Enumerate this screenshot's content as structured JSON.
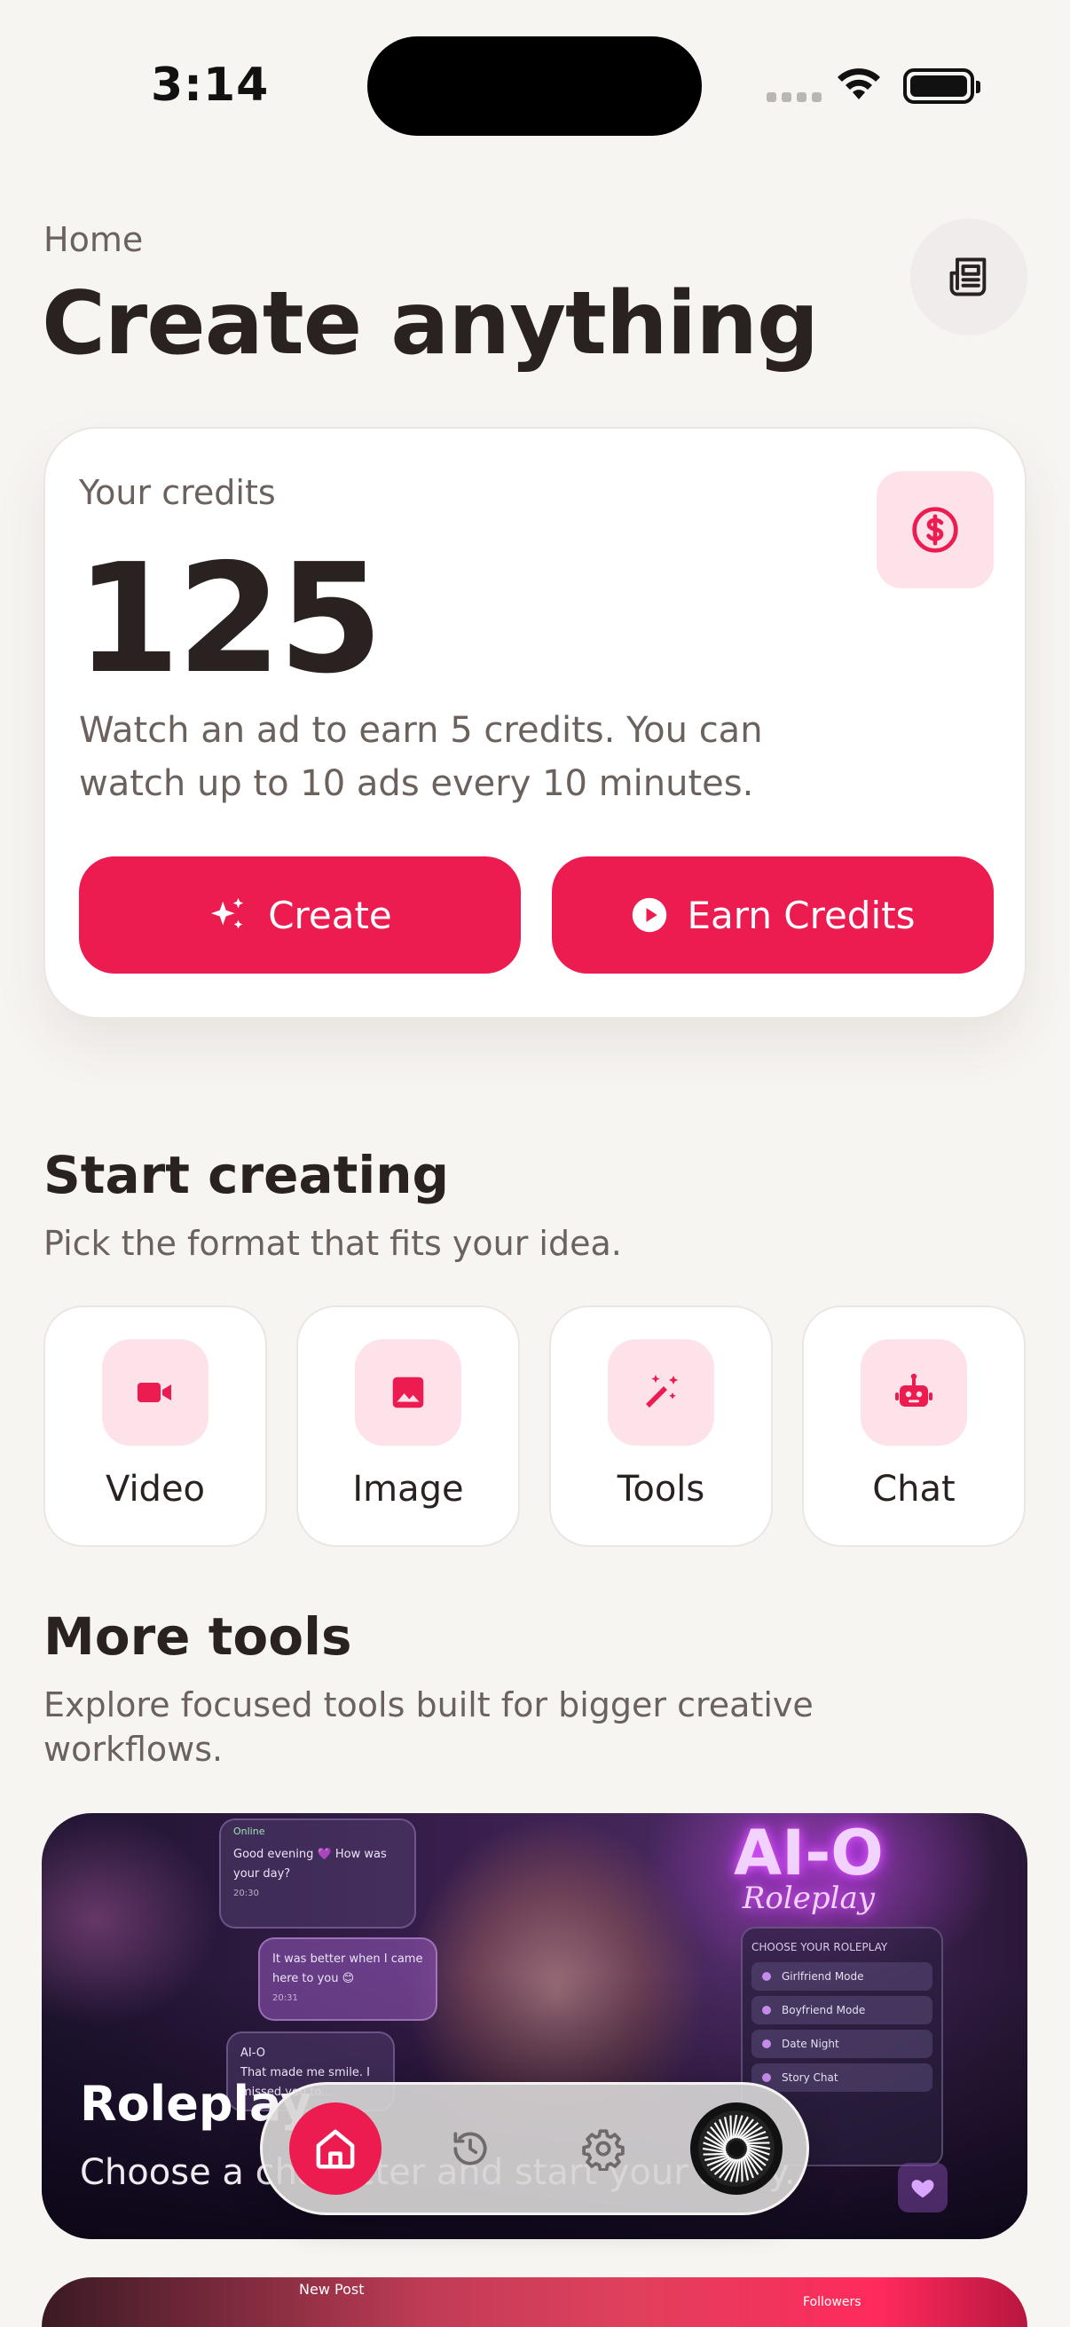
{
  "status_bar": {
    "time": "3:14"
  },
  "header": {
    "breadcrumb": "Home",
    "title": "Create anything"
  },
  "credits": {
    "label": "Your credits",
    "value": "125",
    "description": "Watch an ad to earn 5 credits. You can watch up to 10 ads every 10 minutes.",
    "create_label": "Create",
    "earn_label": "Earn Credits"
  },
  "start_creating": {
    "title": "Start creating",
    "subtitle": "Pick the format that fits your idea.",
    "formats": [
      {
        "label": "Video",
        "icon": "video-camera-icon"
      },
      {
        "label": "Image",
        "icon": "image-icon"
      },
      {
        "label": "Tools",
        "icon": "magic-wand-icon"
      },
      {
        "label": "Chat",
        "icon": "robot-icon"
      }
    ]
  },
  "more_tools": {
    "title": "More tools",
    "subtitle": "Explore focused tools built for bigger creative workflows.",
    "promo": {
      "title": "Roleplay",
      "subtitle": "Choose a character and start your story.",
      "artwork": {
        "status": "Online",
        "bubble1": "Good evening 💜 How was your day?",
        "bubble1_time": "20:30",
        "bubble2": "It was better when I came here to you 😊",
        "bubble2_time": "20:31",
        "bubble3_name": "AI-O",
        "bubble3": "That made me smile. I missed you to...",
        "neon_title": "AI-O",
        "neon_sub": "Roleplay",
        "panel_title": "CHOOSE YOUR ROLEPLAY",
        "panel_items": [
          "Girlfriend Mode",
          "Boyfriend Mode",
          "Date Night",
          "Story Chat"
        ]
      }
    },
    "promo2": {
      "label_left": "New Post",
      "label_right": "Followers"
    }
  },
  "tab_bar": {
    "items": [
      "home-icon",
      "history-icon",
      "settings-icon",
      "profile-icon"
    ],
    "active": "home"
  },
  "colors": {
    "accent": "#ec1c50",
    "accent_soft": "#fde3e9",
    "text": "#2a2220",
    "muted": "#6b625e",
    "background": "#f7f5f2"
  }
}
